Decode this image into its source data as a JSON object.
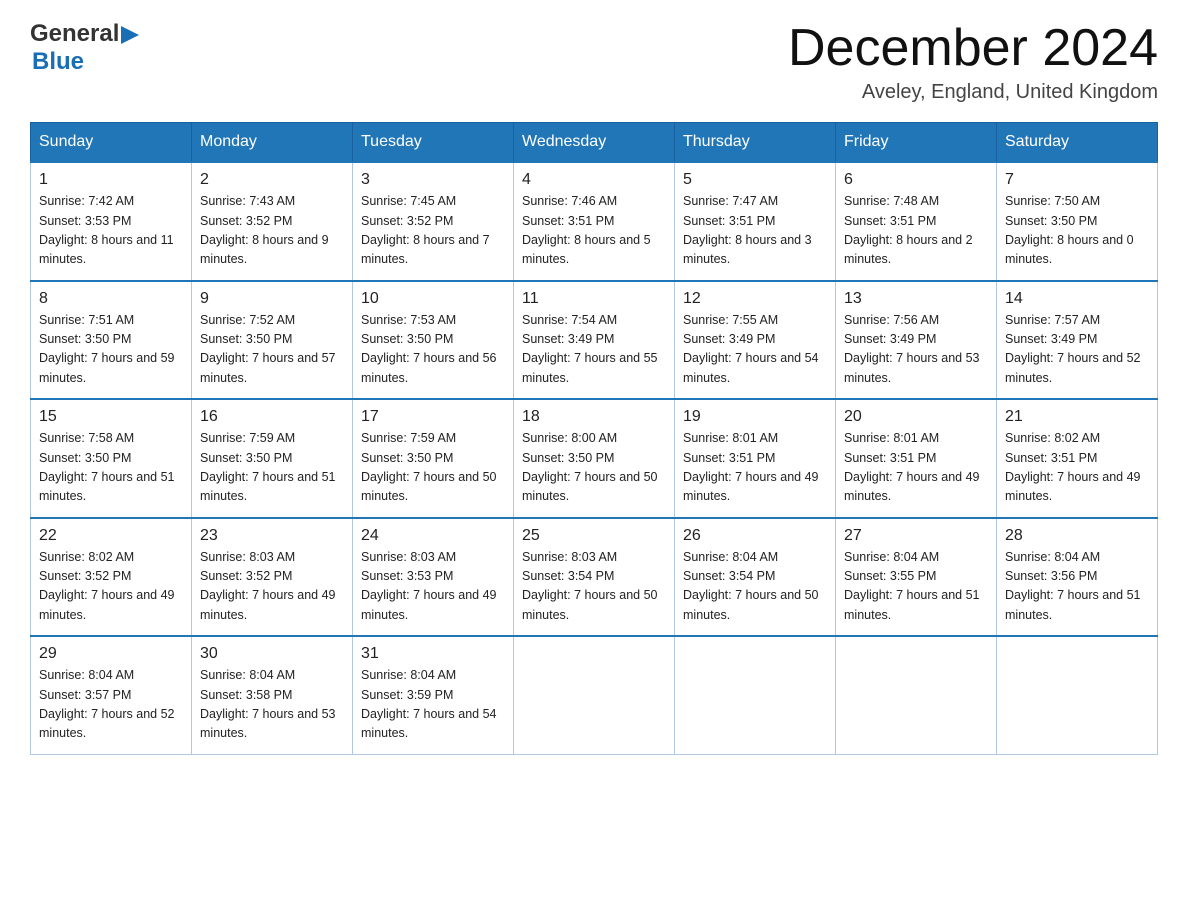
{
  "header": {
    "logo_line1": "General",
    "logo_arrow": "▶",
    "logo_line2": "Blue",
    "month_title": "December 2024",
    "location": "Aveley, England, United Kingdom"
  },
  "weekdays": [
    "Sunday",
    "Monday",
    "Tuesday",
    "Wednesday",
    "Thursday",
    "Friday",
    "Saturday"
  ],
  "weeks": [
    [
      {
        "day": "1",
        "sunrise": "7:42 AM",
        "sunset": "3:53 PM",
        "daylight": "8 hours and 11 minutes."
      },
      {
        "day": "2",
        "sunrise": "7:43 AM",
        "sunset": "3:52 PM",
        "daylight": "8 hours and 9 minutes."
      },
      {
        "day": "3",
        "sunrise": "7:45 AM",
        "sunset": "3:52 PM",
        "daylight": "8 hours and 7 minutes."
      },
      {
        "day": "4",
        "sunrise": "7:46 AM",
        "sunset": "3:51 PM",
        "daylight": "8 hours and 5 minutes."
      },
      {
        "day": "5",
        "sunrise": "7:47 AM",
        "sunset": "3:51 PM",
        "daylight": "8 hours and 3 minutes."
      },
      {
        "day": "6",
        "sunrise": "7:48 AM",
        "sunset": "3:51 PM",
        "daylight": "8 hours and 2 minutes."
      },
      {
        "day": "7",
        "sunrise": "7:50 AM",
        "sunset": "3:50 PM",
        "daylight": "8 hours and 0 minutes."
      }
    ],
    [
      {
        "day": "8",
        "sunrise": "7:51 AM",
        "sunset": "3:50 PM",
        "daylight": "7 hours and 59 minutes."
      },
      {
        "day": "9",
        "sunrise": "7:52 AM",
        "sunset": "3:50 PM",
        "daylight": "7 hours and 57 minutes."
      },
      {
        "day": "10",
        "sunrise": "7:53 AM",
        "sunset": "3:50 PM",
        "daylight": "7 hours and 56 minutes."
      },
      {
        "day": "11",
        "sunrise": "7:54 AM",
        "sunset": "3:49 PM",
        "daylight": "7 hours and 55 minutes."
      },
      {
        "day": "12",
        "sunrise": "7:55 AM",
        "sunset": "3:49 PM",
        "daylight": "7 hours and 54 minutes."
      },
      {
        "day": "13",
        "sunrise": "7:56 AM",
        "sunset": "3:49 PM",
        "daylight": "7 hours and 53 minutes."
      },
      {
        "day": "14",
        "sunrise": "7:57 AM",
        "sunset": "3:49 PM",
        "daylight": "7 hours and 52 minutes."
      }
    ],
    [
      {
        "day": "15",
        "sunrise": "7:58 AM",
        "sunset": "3:50 PM",
        "daylight": "7 hours and 51 minutes."
      },
      {
        "day": "16",
        "sunrise": "7:59 AM",
        "sunset": "3:50 PM",
        "daylight": "7 hours and 51 minutes."
      },
      {
        "day": "17",
        "sunrise": "7:59 AM",
        "sunset": "3:50 PM",
        "daylight": "7 hours and 50 minutes."
      },
      {
        "day": "18",
        "sunrise": "8:00 AM",
        "sunset": "3:50 PM",
        "daylight": "7 hours and 50 minutes."
      },
      {
        "day": "19",
        "sunrise": "8:01 AM",
        "sunset": "3:51 PM",
        "daylight": "7 hours and 49 minutes."
      },
      {
        "day": "20",
        "sunrise": "8:01 AM",
        "sunset": "3:51 PM",
        "daylight": "7 hours and 49 minutes."
      },
      {
        "day": "21",
        "sunrise": "8:02 AM",
        "sunset": "3:51 PM",
        "daylight": "7 hours and 49 minutes."
      }
    ],
    [
      {
        "day": "22",
        "sunrise": "8:02 AM",
        "sunset": "3:52 PM",
        "daylight": "7 hours and 49 minutes."
      },
      {
        "day": "23",
        "sunrise": "8:03 AM",
        "sunset": "3:52 PM",
        "daylight": "7 hours and 49 minutes."
      },
      {
        "day": "24",
        "sunrise": "8:03 AM",
        "sunset": "3:53 PM",
        "daylight": "7 hours and 49 minutes."
      },
      {
        "day": "25",
        "sunrise": "8:03 AM",
        "sunset": "3:54 PM",
        "daylight": "7 hours and 50 minutes."
      },
      {
        "day": "26",
        "sunrise": "8:04 AM",
        "sunset": "3:54 PM",
        "daylight": "7 hours and 50 minutes."
      },
      {
        "day": "27",
        "sunrise": "8:04 AM",
        "sunset": "3:55 PM",
        "daylight": "7 hours and 51 minutes."
      },
      {
        "day": "28",
        "sunrise": "8:04 AM",
        "sunset": "3:56 PM",
        "daylight": "7 hours and 51 minutes."
      }
    ],
    [
      {
        "day": "29",
        "sunrise": "8:04 AM",
        "sunset": "3:57 PM",
        "daylight": "7 hours and 52 minutes."
      },
      {
        "day": "30",
        "sunrise": "8:04 AM",
        "sunset": "3:58 PM",
        "daylight": "7 hours and 53 minutes."
      },
      {
        "day": "31",
        "sunrise": "8:04 AM",
        "sunset": "3:59 PM",
        "daylight": "7 hours and 54 minutes."
      },
      null,
      null,
      null,
      null
    ]
  ],
  "labels": {
    "sunrise": "Sunrise:",
    "sunset": "Sunset:",
    "daylight": "Daylight:"
  }
}
